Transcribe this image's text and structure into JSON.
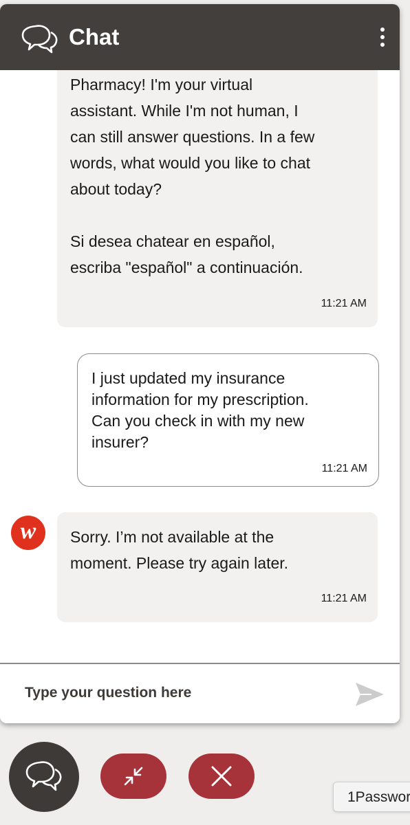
{
  "header": {
    "title": "Chat",
    "icon": "chat-bubbles-icon",
    "menu_icon": "more-vertical-icon"
  },
  "messages": [
    {
      "sender": "bot",
      "text": "Pharmacy! I'm your virtual\nassistant. While I'm not human, I\ncan still answer questions. In a few\nwords, what would you like to chat\nabout today?\n\nSi desea chatear en español,\nescriba \"español\" a continuación.",
      "time": "11:21 AM"
    },
    {
      "sender": "user",
      "text": "I just updated my insurance\ninformation for my prescription.\nCan you check in with my new\ninsurer?",
      "time": "11:21 AM"
    },
    {
      "sender": "bot",
      "text": "Sorry. I’m not available at the\nmoment. Please try again later.",
      "time": "11:21 AM",
      "avatar_letter": "w"
    }
  ],
  "composer": {
    "placeholder": "Type your question here",
    "send_icon": "send-icon"
  },
  "launcher": {
    "chat_icon": "chat-bubbles-icon",
    "minimize_icon": "minimize-arrows-icon",
    "close_icon": "close-icon"
  },
  "tooltip": {
    "text": "1Passwor"
  },
  "colors": {
    "header_bg": "#423f3d",
    "bot_bubble_bg": "#f2f1ef",
    "accent_red": "#a7333a",
    "avatar_red": "#e0311e",
    "send_icon": "#cccccc"
  }
}
